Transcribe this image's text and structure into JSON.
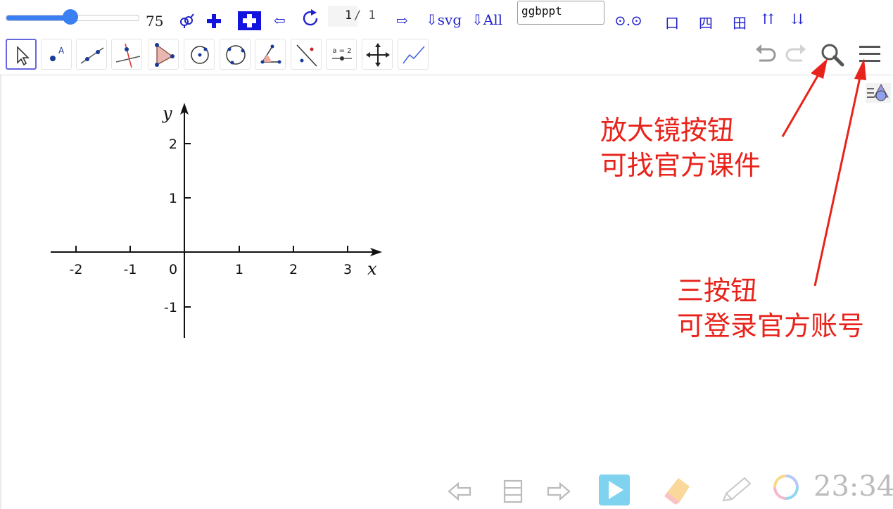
{
  "topbar": {
    "slider_value": 0.49,
    "zoom_value": "75",
    "page_current": "1",
    "page_separator": "/",
    "page_total": "1",
    "export_svg": "⇩svg",
    "export_all": "⇩All",
    "text_field_value": "ggbppt",
    "view_buttons": [
      "⊙.⊙",
      "口",
      "四",
      "田",
      "⇈",
      "⇊"
    ],
    "arrow_left": "⇦",
    "arrow_right": "⇨"
  },
  "toolbar": {
    "tools": [
      "move",
      "point",
      "line",
      "perpendicular-line",
      "polygon",
      "circle-center",
      "circle-three-points",
      "angle",
      "reflect",
      "slider",
      "move-graphics-view",
      "freehand"
    ],
    "selected_tool": "move",
    "slider_tool_label": "a = 2",
    "point_label": "A"
  },
  "graph": {
    "x_ticks": [
      "-2",
      "-1",
      "0",
      "1",
      "2",
      "3"
    ],
    "y_ticks": [
      "2",
      "1",
      "-1"
    ],
    "x_axis_label": "x",
    "y_axis_label": "y"
  },
  "annotations": {
    "search_note_line1": "放大镜按钮",
    "search_note_line2": "可找官方课件",
    "menu_note_line1": "三按钮",
    "menu_note_line2": "可登录官方账号"
  },
  "bottombar": {
    "time": "23:34"
  },
  "colors": {
    "annotation": "#e8231b",
    "toolbar_blue": "#2222cc",
    "slider": "#3b80f3",
    "selected_tool_border": "#6666dd"
  }
}
